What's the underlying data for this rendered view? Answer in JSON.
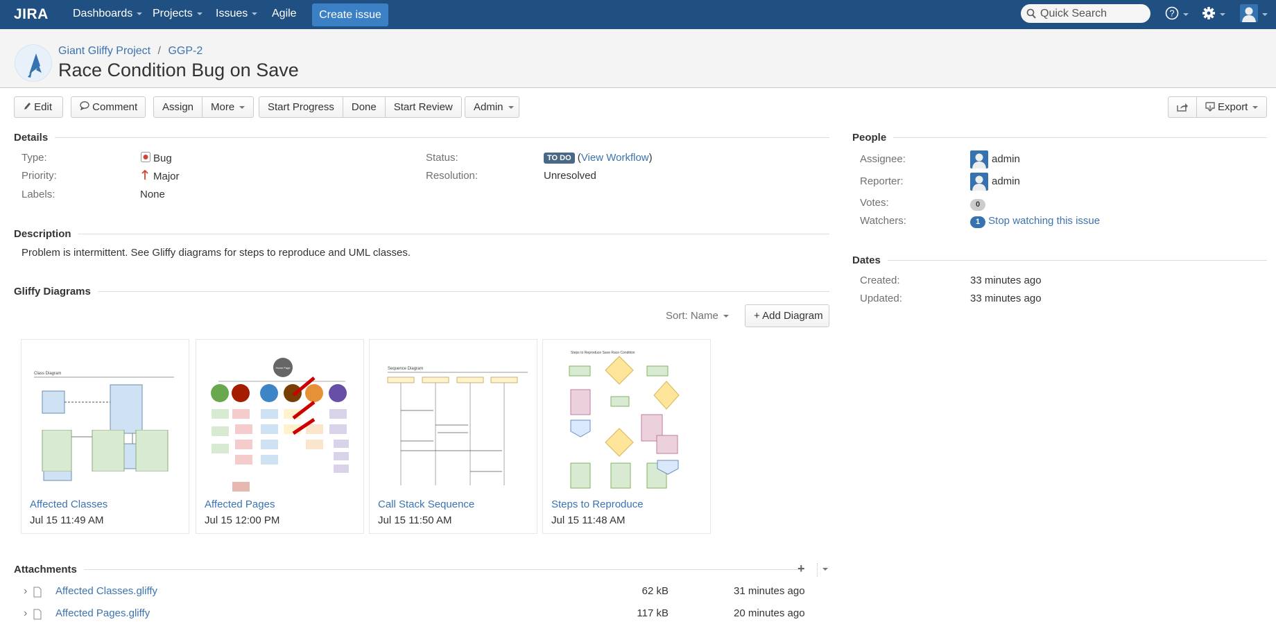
{
  "topbar": {
    "logo": "JIRA",
    "nav": [
      "Dashboards",
      "Projects",
      "Issues",
      "Agile"
    ],
    "create_issue": "Create issue",
    "quick_search_placeholder": "Quick Search"
  },
  "header": {
    "project": "Giant Gliffy Project",
    "separator": "/",
    "issue_key": "GGP-2",
    "title": "Race Condition Bug on Save"
  },
  "toolbar": {
    "edit": "Edit",
    "comment": "Comment",
    "assign": "Assign",
    "more": "More",
    "start_progress": "Start Progress",
    "done": "Done",
    "start_review": "Start Review",
    "admin": "Admin",
    "export": "Export"
  },
  "details": {
    "heading": "Details",
    "type_label": "Type:",
    "type": "Bug",
    "priority_label": "Priority:",
    "priority": "Major",
    "labels_label": "Labels:",
    "labels": "None",
    "status_label": "Status:",
    "status": "TO DO",
    "view_workflow": "View Workflow",
    "resolution_label": "Resolution:",
    "resolution": "Unresolved",
    "status_color": "#4a6785"
  },
  "description": {
    "heading": "Description",
    "text": "Problem is intermittent. See Gliffy diagrams for steps to reproduce and UML classes."
  },
  "gliffy": {
    "heading": "Gliffy Diagrams",
    "sort": "Sort: Name",
    "add": "+ Add Diagram",
    "diagrams": [
      {
        "name": "Affected Classes",
        "date": "Jul 15 11:49 AM",
        "thumb_title": "Class Diagram"
      },
      {
        "name": "Affected Pages",
        "date": "Jul 15 12:00 PM",
        "thumb_title": "Home Page"
      },
      {
        "name": "Call Stack Sequence",
        "date": "Jul 15 11:50 AM",
        "thumb_title": "Sequence Diagram"
      },
      {
        "name": "Steps to Reproduce",
        "date": "Jul 15 11:48 AM",
        "thumb_title": "Steps to Reproduce Save Race Condition"
      }
    ]
  },
  "attachments": {
    "heading": "Attachments",
    "files": [
      {
        "name": "Affected Classes.gliffy",
        "size": "62 kB",
        "age": "31 minutes ago"
      },
      {
        "name": "Affected Pages.gliffy",
        "size": "117 kB",
        "age": "20 minutes ago"
      }
    ]
  },
  "people": {
    "heading": "People",
    "assignee_label": "Assignee:",
    "assignee": "admin",
    "reporter_label": "Reporter:",
    "reporter": "admin",
    "votes_label": "Votes:",
    "votes": "0",
    "watchers_label": "Watchers:",
    "watchers": "1",
    "stop_watching": "Stop watching this issue"
  },
  "dates": {
    "heading": "Dates",
    "created_label": "Created:",
    "created": "33 minutes ago",
    "updated_label": "Updated:",
    "updated": "33 minutes ago"
  }
}
